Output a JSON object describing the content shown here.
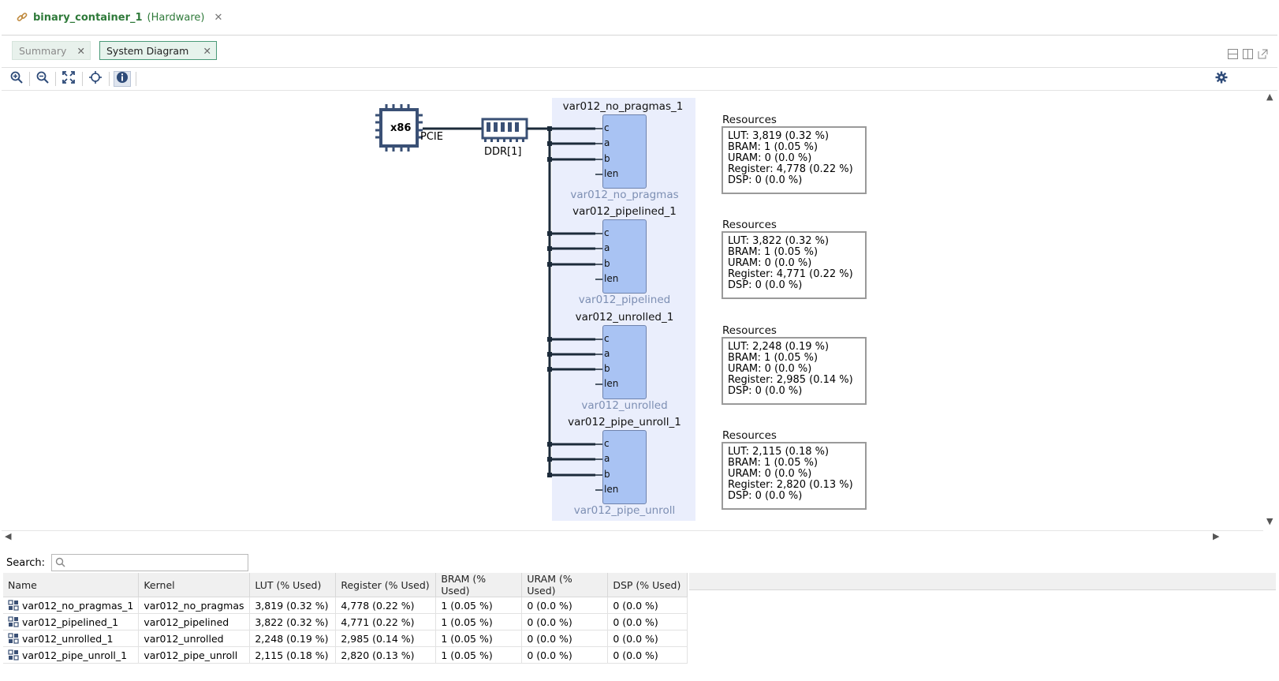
{
  "window": {
    "title": "binary_container_1",
    "subtitle": "(Hardware)",
    "close_glyph": "✕",
    "icon": "link-icon"
  },
  "tabs": [
    {
      "label": "Summary",
      "active": false,
      "close_glyph": "✕"
    },
    {
      "label": "System Diagram",
      "active": true,
      "close_glyph": "✕"
    }
  ],
  "toolbar": {
    "buttons": [
      "zoom-in-icon",
      "zoom-out-icon",
      "fit-view-icon",
      "locate-icon",
      "info-icon"
    ],
    "right_button": "gear-icon"
  },
  "diagram": {
    "host_label": "x86",
    "pcie_label": "PCIE",
    "memory_label": "DDR[1]",
    "kernels": [
      {
        "instance": "var012_no_pragmas_1",
        "kernel": "var012_no_pragmas",
        "ports": [
          "c",
          "a",
          "b",
          "len"
        ],
        "resources_title": "Resources",
        "resources": [
          "LUT: 3,819 (0.32 %)",
          "BRAM: 1 (0.05 %)",
          "URAM: 0 (0.0 %)",
          "Register: 4,778 (0.22 %)",
          "DSP: 0 (0.0 %)"
        ]
      },
      {
        "instance": "var012_pipelined_1",
        "kernel": "var012_pipelined",
        "ports": [
          "c",
          "a",
          "b",
          "len"
        ],
        "resources_title": "Resources",
        "resources": [
          "LUT: 3,822 (0.32 %)",
          "BRAM: 1 (0.05 %)",
          "URAM: 0 (0.0 %)",
          "Register: 4,771 (0.22 %)",
          "DSP: 0 (0.0 %)"
        ]
      },
      {
        "instance": "var012_unrolled_1",
        "kernel": "var012_unrolled",
        "ports": [
          "c",
          "a",
          "b",
          "len"
        ],
        "resources_title": "Resources",
        "resources": [
          "LUT: 2,248 (0.19 %)",
          "BRAM: 1 (0.05 %)",
          "URAM: 0 (0.0 %)",
          "Register: 2,985 (0.14 %)",
          "DSP: 0 (0.0 %)"
        ]
      },
      {
        "instance": "var012_pipe_unroll_1",
        "kernel": "var012_pipe_unroll",
        "ports": [
          "c",
          "a",
          "b",
          "len"
        ],
        "resources_title": "Resources",
        "resources": [
          "LUT: 2,115 (0.18 %)",
          "BRAM: 1 (0.05 %)",
          "URAM: 0 (0.0 %)",
          "Register: 2,820 (0.13 %)",
          "DSP: 0 (0.0 %)"
        ]
      }
    ]
  },
  "search": {
    "label": "Search:",
    "placeholder": "",
    "value": ""
  },
  "table": {
    "headers": [
      "Name",
      "Kernel",
      "LUT (% Used)",
      "Register (% Used)",
      "BRAM (% Used)",
      "URAM (% Used)",
      "DSP (% Used)"
    ],
    "rows": [
      [
        "var012_no_pragmas_1",
        "var012_no_pragmas",
        "3,819 (0.32 %)",
        "4,778 (0.22 %)",
        "1 (0.05 %)",
        "0 (0.0 %)",
        "0 (0.0 %)"
      ],
      [
        "var012_pipelined_1",
        "var012_pipelined",
        "3,822 (0.32 %)",
        "4,771 (0.22 %)",
        "1 (0.05 %)",
        "0 (0.0 %)",
        "0 (0.0 %)"
      ],
      [
        "var012_unrolled_1",
        "var012_unrolled",
        "2,248 (0.19 %)",
        "2,985 (0.14 %)",
        "1 (0.05 %)",
        "0 (0.0 %)",
        "0 (0.0 %)"
      ],
      [
        "var012_pipe_unroll_1",
        "var012_pipe_unroll",
        "2,115 (0.18 %)",
        "2,820 (0.13 %)",
        "1 (0.05 %)",
        "0 (0.0 %)",
        "0 (0.0 %)"
      ]
    ],
    "row_icon": "kernel-instance-icon"
  },
  "colors": {
    "accent_green": "#2f7a3a",
    "kernel_fill": "#a9c3f3",
    "compute_unit_bg": "#eaeefc",
    "wire": "#1c2b3a",
    "host_icon": "#3a5075"
  }
}
